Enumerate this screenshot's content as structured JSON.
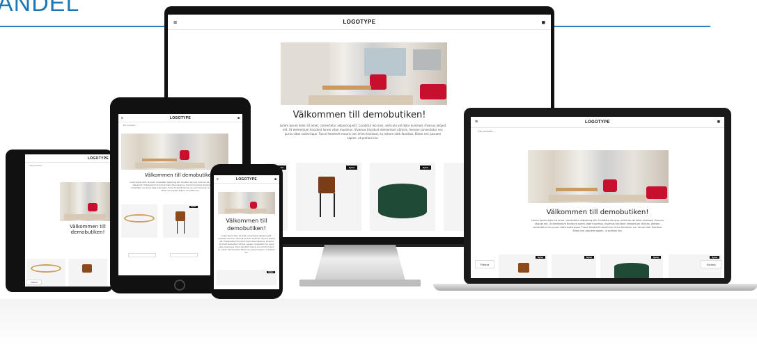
{
  "heading": "ANDEL",
  "logo": "LOGOTYPE",
  "welcome": "Välkommen till demobutiken!",
  "lorem": "Lorem ipsum dolor sit amet, consectetur adipiscing elit. Curabitur leo eros, vehicula vel dolor euismod, rhoncus aliquet elit. Ut elementum tincidunt lorem vitae maximus. Vivamus tincidunt elementum ultrices. Aenean consectetur nec purus vitae scelerisque. Fusce hendrerit mauris nec enim tincidunt, eu rutrum nibh faucibus. Etiam nec posuere sapien, ut pretium leo.",
  "badge": "Nyhet",
  "search_placeholder": "Sök produkter ...",
  "filter_label": "Filtrera",
  "sort_label": "Sortera",
  "menu_icon": "hamburger-icon",
  "cart_icon": "bag-icon",
  "colors": {
    "accent": "#1f77b4",
    "badge": "#111111",
    "sofa": "#c8102e"
  }
}
